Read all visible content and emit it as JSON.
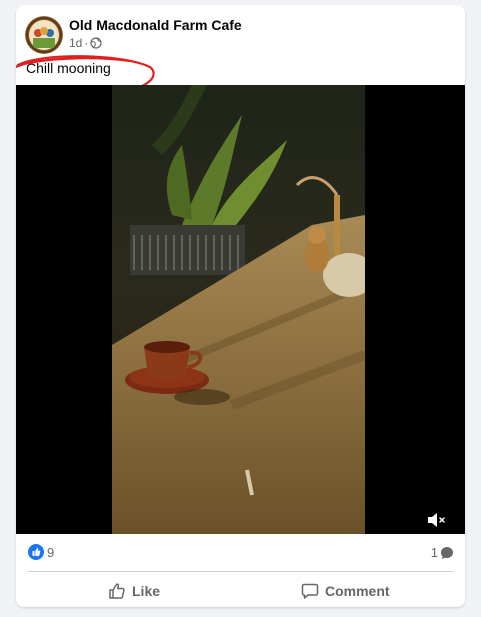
{
  "post": {
    "page_name": "Old Macdonald Farm Cafe",
    "time": "1d",
    "visibility_icon": "globe-icon",
    "text": "Chill mooning"
  },
  "media": {
    "type": "video",
    "muted": true,
    "mute_icon": "speaker-muted-icon"
  },
  "reactions": {
    "like_count": "9",
    "comment_count": "1"
  },
  "actions": {
    "like_label": "Like",
    "comment_label": "Comment"
  },
  "colors": {
    "brand_blue": "#1877f2",
    "annotation_red": "#e02020",
    "secondary_text": "#65676b"
  }
}
